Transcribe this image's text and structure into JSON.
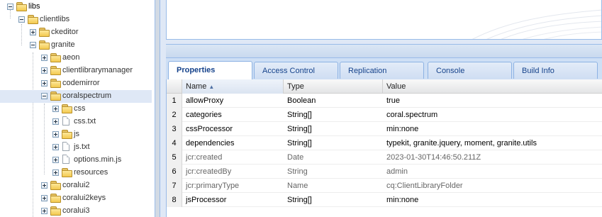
{
  "tree": {
    "nodes": [
      {
        "label": "libs",
        "toggle": "minus",
        "icon": "folder-icon"
      },
      {
        "label": "clientlibs",
        "toggle": "minus",
        "icon": "folder-icon"
      },
      {
        "label": "ckeditor",
        "toggle": "plus",
        "icon": "folder-icon"
      },
      {
        "label": "granite",
        "toggle": "minus",
        "icon": "folder-icon"
      },
      {
        "label": "aeon",
        "toggle": "plus",
        "icon": "folder-icon"
      },
      {
        "label": "clientlibrarymanager",
        "toggle": "plus",
        "icon": "folder-icon"
      },
      {
        "label": "codemirror",
        "toggle": "plus",
        "icon": "folder-icon"
      },
      {
        "label": "coralspectrum",
        "toggle": "minus",
        "icon": "folder-icon",
        "selected": true
      },
      {
        "label": "css",
        "toggle": "plus",
        "icon": "folder-icon"
      },
      {
        "label": "css.txt",
        "toggle": "plus",
        "icon": "file-icon"
      },
      {
        "label": "js",
        "toggle": "plus",
        "icon": "folder-icon"
      },
      {
        "label": "js.txt",
        "toggle": "plus",
        "icon": "file-icon"
      },
      {
        "label": "options.min.js",
        "toggle": "plus",
        "icon": "file-icon"
      },
      {
        "label": "resources",
        "toggle": "plus",
        "icon": "folder-icon"
      },
      {
        "label": "coralui2",
        "toggle": "plus",
        "icon": "folder-icon"
      },
      {
        "label": "coralui2keys",
        "toggle": "plus",
        "icon": "folder-icon"
      },
      {
        "label": "coralui3",
        "toggle": "plus",
        "icon": "folder-icon"
      }
    ]
  },
  "tabs": [
    {
      "label": "Properties",
      "active": true
    },
    {
      "label": "Access Control"
    },
    {
      "label": "Replication"
    },
    {
      "label": "Console"
    },
    {
      "label": "Build Info"
    }
  ],
  "grid": {
    "columns": {
      "name": "Name",
      "type": "Type",
      "value": "Value",
      "sort_icon": "sort-ascending-icon"
    },
    "rows": [
      {
        "num": "1",
        "name": "allowProxy",
        "type": "Boolean",
        "value": "true"
      },
      {
        "num": "2",
        "name": "categories",
        "type": "String[]",
        "value": "coral.spectrum"
      },
      {
        "num": "3",
        "name": "cssProcessor",
        "type": "String[]",
        "value": "min:none"
      },
      {
        "num": "4",
        "name": "dependencies",
        "type": "String[]",
        "value": "typekit, granite.jquery, moment, granite.utils"
      },
      {
        "num": "5",
        "name": "jcr:created",
        "type": "Date",
        "value": "2023-01-30T14:46:50.211Z",
        "inherited": true
      },
      {
        "num": "6",
        "name": "jcr:createdBy",
        "type": "String",
        "value": "admin",
        "inherited": true
      },
      {
        "num": "7",
        "name": "jcr:primaryType",
        "type": "Name",
        "value": "cq:ClientLibraryFolder",
        "inherited": true
      },
      {
        "num": "8",
        "name": "jsProcessor",
        "type": "String[]",
        "value": "min:none"
      }
    ]
  },
  "colors": {
    "accent": "#15428b",
    "selection": "#dfe8f6",
    "panel": "#dfe8f6"
  }
}
